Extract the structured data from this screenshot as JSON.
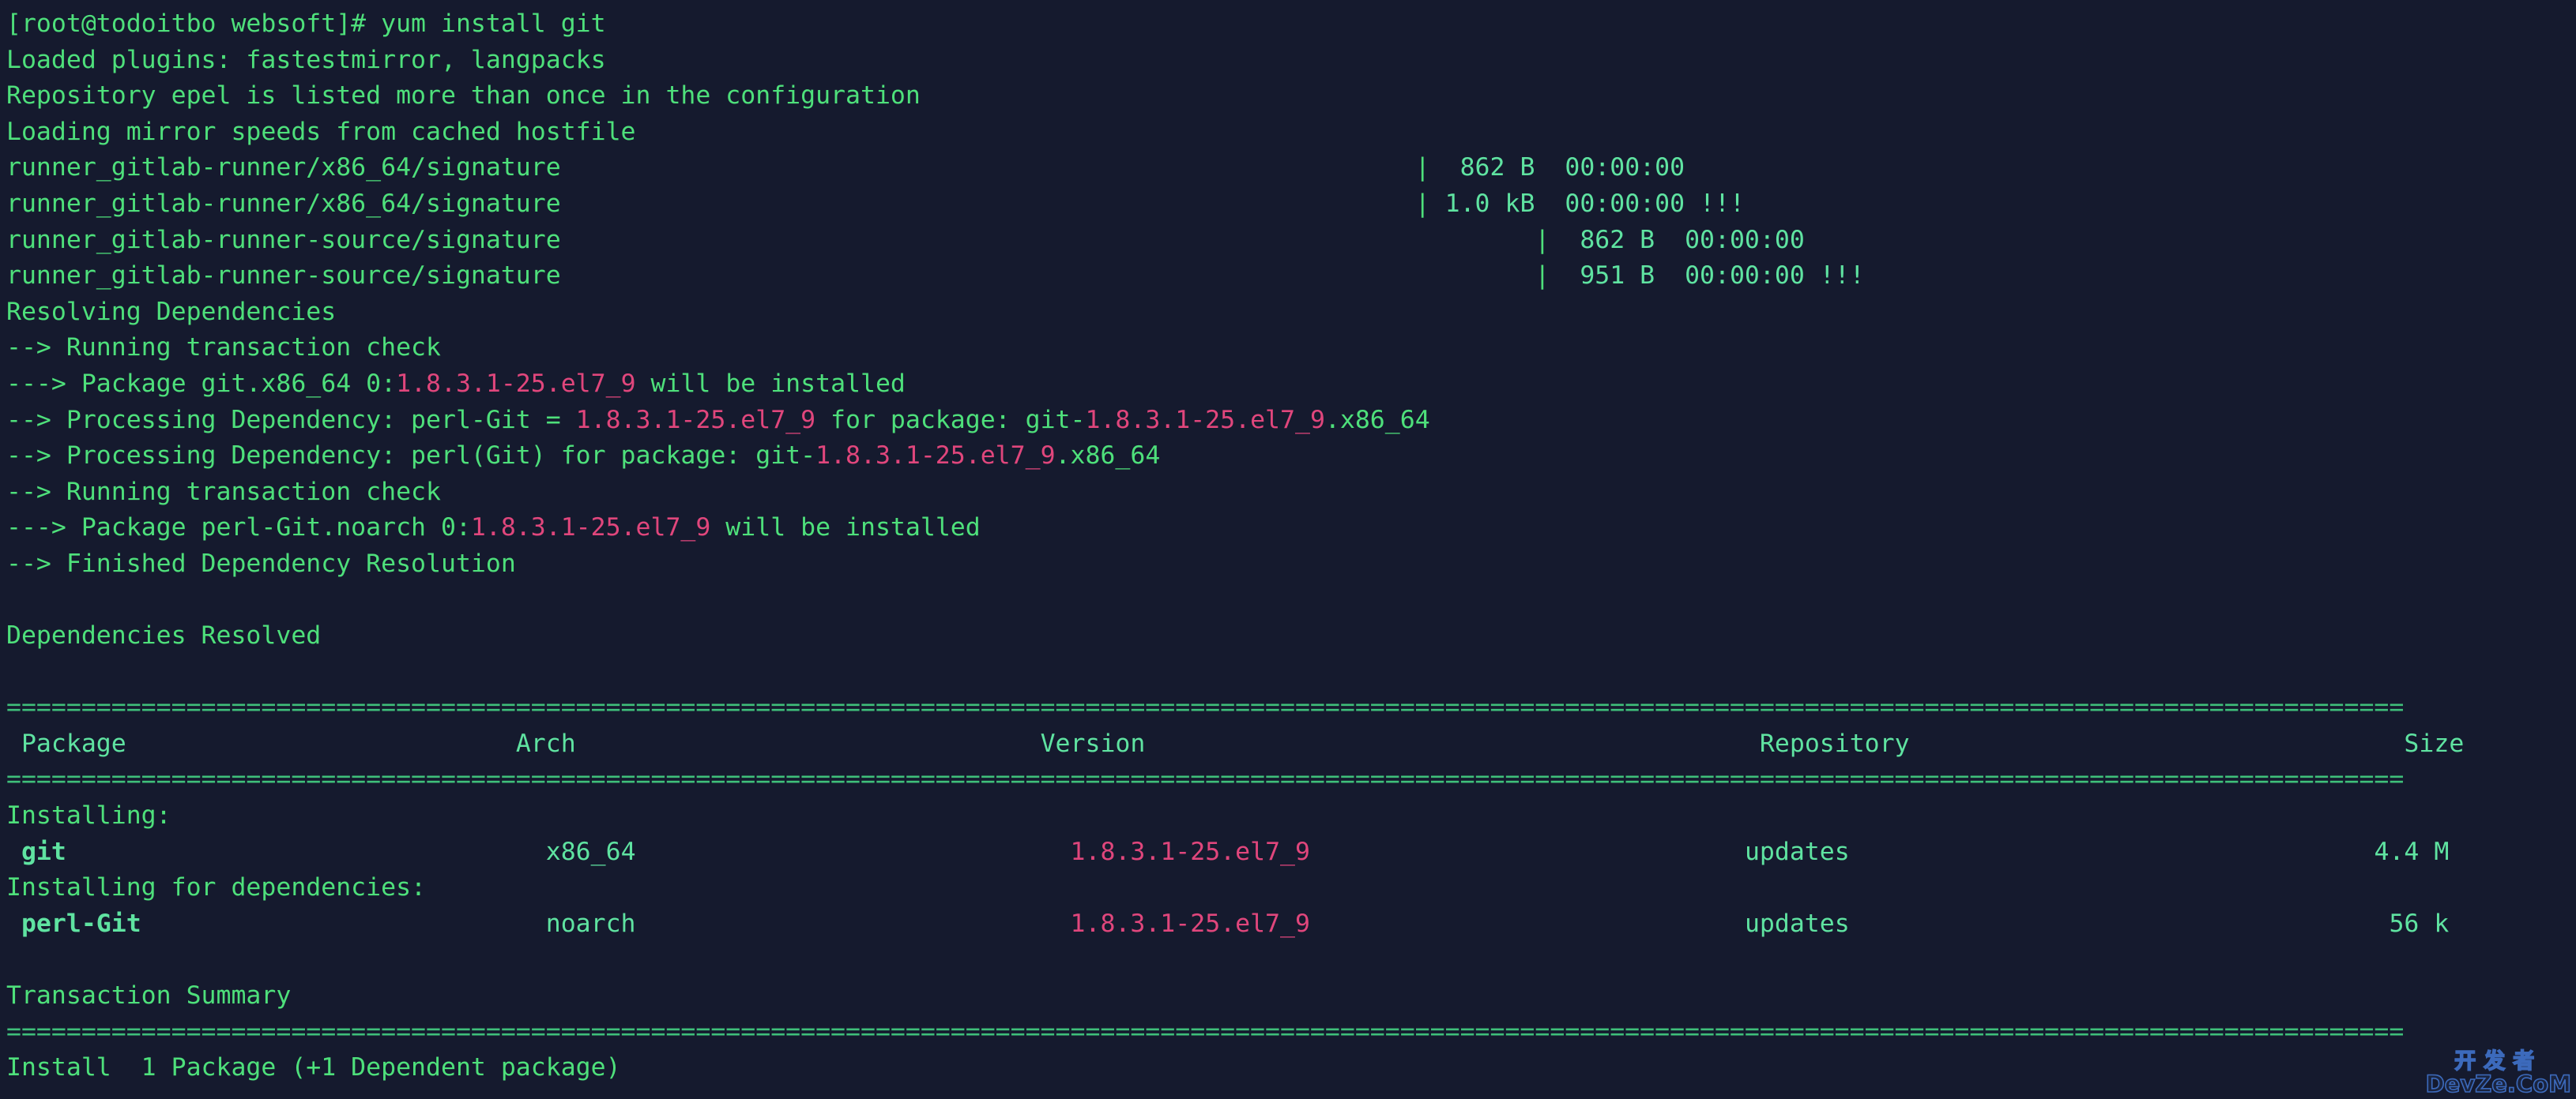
{
  "terminal": {
    "background_color": "#151a2e",
    "foreground_color": "#4ee07b",
    "accent_version_color": "#e0467c",
    "header_color": "#5fe3a1",
    "separator_color": "#3fbf7a"
  },
  "prompt": {
    "text": "[root@todoitbo websoft]# ",
    "user": "root",
    "host": "todoitbo",
    "cwd": "websoft",
    "symbol": "#",
    "command": "yum install git"
  },
  "output": {
    "loaded_plugins": "Loaded plugins: fastestmirror, langpacks",
    "repo_warning": "Repository epel is listed more than once in the configuration",
    "loading_mirror": "Loading mirror speeds from cached hostfile",
    "resolving": "Resolving Dependencies",
    "running_check_1": "--> Running transaction check",
    "pkg_git_prefix": "---> Package git.x86_64 0:",
    "pkg_git_version": "1.8.3.1-25.el7_9",
    "pkg_git_suffix": " will be installed",
    "dep1_prefix": "--> Processing Dependency: perl-Git = ",
    "dep1_version": "1.8.3.1-25.el7_9",
    "dep1_mid": " for package: git-",
    "dep1_version2": "1.8.3.1-25.el7_9",
    "dep1_suffix": ".x86_64",
    "dep2_prefix": "--> Processing Dependency: perl(Git) for package: git-",
    "dep2_version": "1.8.3.1-25.el7_9",
    "dep2_suffix": ".x86_64",
    "running_check_2": "--> Running transaction check",
    "pkg_perlgit_prefix": "---> Package perl-Git.noarch 0:",
    "pkg_perlgit_version": "1.8.3.1-25.el7_9",
    "pkg_perlgit_suffix": " will be installed",
    "finished": "--> Finished Dependency Resolution",
    "dependencies_resolved": "Dependencies Resolved"
  },
  "mirror_rows": [
    {
      "name": "runner_gitlab-runner/x86_64/signature",
      "pipe": "|",
      "size": "862 B",
      "time": "00:00:00",
      "flag": ""
    },
    {
      "name": "runner_gitlab-runner/x86_64/signature",
      "pipe": "|",
      "size": "1.0 kB",
      "time": "00:00:00",
      "flag": "!!!"
    },
    {
      "name": "runner_gitlab-runner-source/signature",
      "pipe": "|",
      "size": "862 B",
      "time": "00:00:00",
      "flag": ""
    },
    {
      "name": "runner_gitlab-runner-source/signature",
      "pipe": "|",
      "size": "951 B",
      "time": "00:00:00",
      "flag": "!!!"
    }
  ],
  "separator": "================================================================================================================================================================",
  "table": {
    "headers": {
      "package": "Package",
      "arch": "Arch",
      "version": "Version",
      "repository": "Repository",
      "size": "Size"
    },
    "sections": [
      {
        "label": "Installing:",
        "rows": [
          {
            "package": "git",
            "arch": "x86_64",
            "version": "1.8.3.1-25.el7_9",
            "repository": "updates",
            "size": "4.4 M"
          }
        ]
      },
      {
        "label": "Installing for dependencies:",
        "rows": [
          {
            "package": "perl-Git",
            "arch": "noarch",
            "version": "1.8.3.1-25.el7_9",
            "repository": "updates",
            "size": "56 k"
          }
        ]
      }
    ]
  },
  "summary": {
    "title": "Transaction Summary",
    "install_line": "Install  1 Package (+1 Dependent package)"
  },
  "watermark": {
    "cn": "开发者",
    "en": "DevZe.CoM",
    "color": "#3f6fc4"
  }
}
